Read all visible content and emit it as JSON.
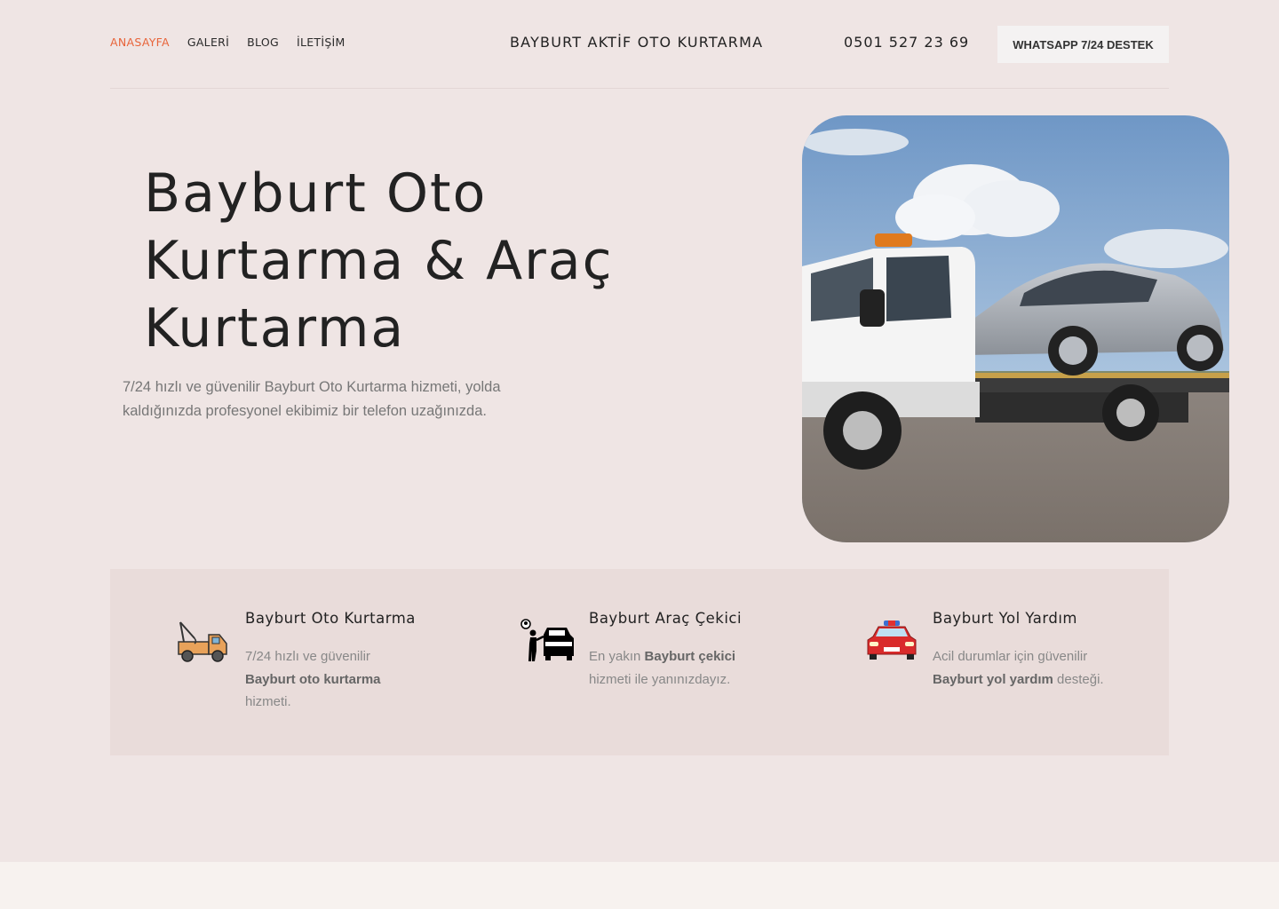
{
  "nav": {
    "items": [
      "ANASAYFA",
      "GALERİ",
      "BLOG",
      "İLETİŞİM"
    ]
  },
  "header": {
    "brand": "BAYBURT AKTİF OTO KURTARMA",
    "phone": "0501 527 23 69",
    "whatsapp_label": "WHATSAPP 7/24 DESTEK"
  },
  "hero": {
    "title_line1": "Bayburt Oto",
    "title_line2": "Kurtarma & Araç",
    "title_line3": "Kurtarma",
    "subtitle": "7/24 hızlı ve güvenilir Bayburt Oto Kurtarma hizmeti, yolda kaldığınızda profesyonel ekibimiz bir telefon uzağınızda."
  },
  "features": [
    {
      "title": "Bayburt Oto Kurtarma",
      "pre": "7/24 hızlı ve güvenilir ",
      "bold": "Bayburt oto kurtarma",
      "post": " hizmeti.",
      "icon": "tow-truck-icon"
    },
    {
      "title": "Bayburt Araç Çekici",
      "pre": "En yakın ",
      "bold": "Bayburt çekici",
      "post": " hizmeti ile yanınızdayız.",
      "icon": "car-driver-icon"
    },
    {
      "title": "Bayburt Yol Yardım",
      "pre": "Acil durumlar için güvenilir ",
      "bold": "Bayburt yol yardım",
      "post": " desteği.",
      "icon": "emergency-car-icon"
    }
  ],
  "colors": {
    "accent": "#e8643a",
    "background": "#efe5e4",
    "panel": "#e9dcda"
  }
}
